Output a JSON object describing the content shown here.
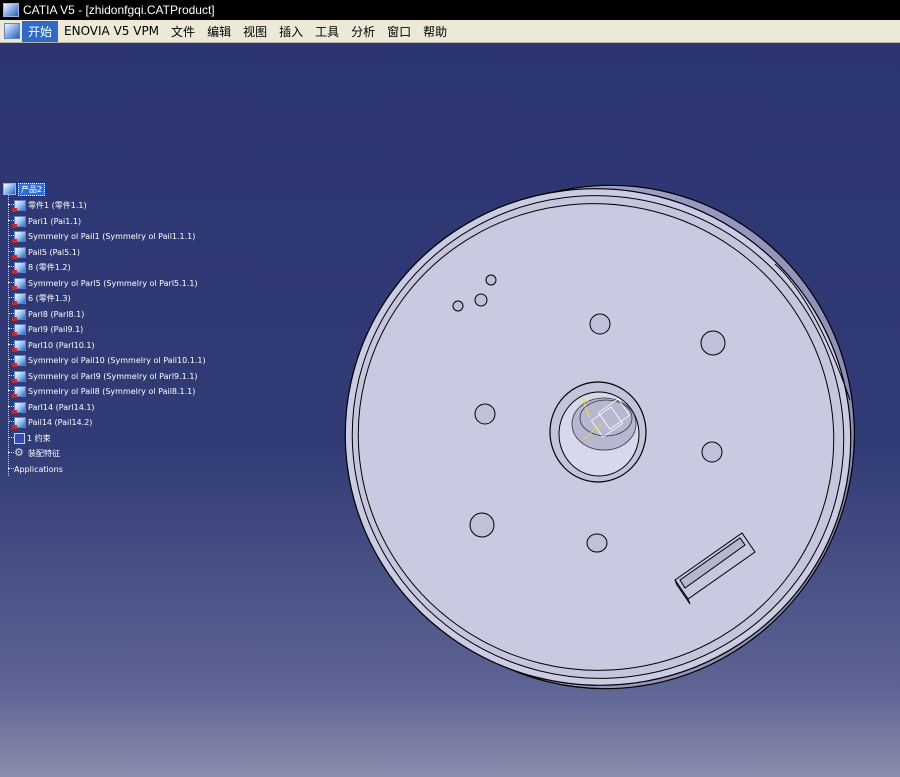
{
  "window": {
    "title": "CATIA V5 - [zhidonfgqi.CATProduct]"
  },
  "menubar": {
    "items": [
      {
        "label": "开始",
        "active": true
      },
      {
        "label": "ENOVIA V5 VPM"
      },
      {
        "label": "文件"
      },
      {
        "label": "编辑"
      },
      {
        "label": "视图"
      },
      {
        "label": "插入"
      },
      {
        "label": "工具"
      },
      {
        "label": "分析"
      },
      {
        "label": "窗口"
      },
      {
        "label": "帮助"
      }
    ]
  },
  "tree": {
    "root_label": "产品2",
    "items": [
      "零件1 (零件1.1)",
      "Pari1 (Pai1.1)",
      "Symmelry ol Pail1 (Symmelry ol Pail1.1.1)",
      "Pail5 (Pal5.1)",
      "8 (零件1.2)",
      "Symmelry ol Parl5 (Symmelry ol Parl5.1.1)",
      "6 (零件1.3)",
      "Parl8 (Parl8.1)",
      "Parl9 (Pail9.1)",
      "Parl10 (Parl10.1)",
      "Symmelry ol Pail10 (Symmelry ol Pail10.1.1)",
      "Symmelry ol Parl9 (Symmelry ol Parl9.1.1)",
      "Symmelry ol Pail8 (Symmelry ol Pail8.1.1)",
      "Parl14 (Parl14.1)",
      "Pail14 (Pail14.2)"
    ],
    "constraints_label": "1 约束",
    "features_label": "装配特征",
    "applications_label": "Applications"
  },
  "colors": {
    "background_top": "#2c3572",
    "background_bottom": "#8a8dae",
    "part_face": "#c9c9e2",
    "part_edge": "#000000",
    "menu_bg": "#ece9d8",
    "selection": "#316ac5"
  }
}
